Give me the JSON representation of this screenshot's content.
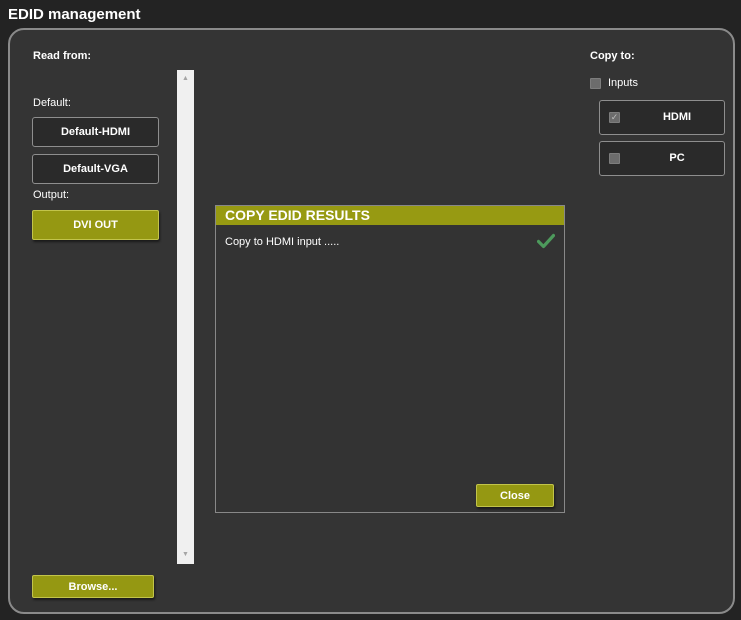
{
  "window": {
    "title": "EDID management"
  },
  "read_from": {
    "label": "Read from:",
    "default_label": "Default:",
    "buttons": [
      "Default-HDMI",
      "Default-VGA"
    ],
    "output_label": "Output:",
    "output_button": "DVI OUT",
    "browse_button": "Browse..."
  },
  "copy_to": {
    "label": "Copy to:",
    "inputs_label": "Inputs",
    "inputs_checked": false,
    "targets": [
      {
        "label": "HDMI",
        "checked": true
      },
      {
        "label": "PC",
        "checked": false
      }
    ]
  },
  "dialog": {
    "title": "COPY EDID RESULTS",
    "message": "Copy to HDMI input .....",
    "status_icon": "checkmark-icon",
    "close_button": "Close"
  },
  "colors": {
    "accent": "#979a12",
    "panel": "#343434",
    "background": "#232323",
    "success": "#4d9a5c"
  }
}
